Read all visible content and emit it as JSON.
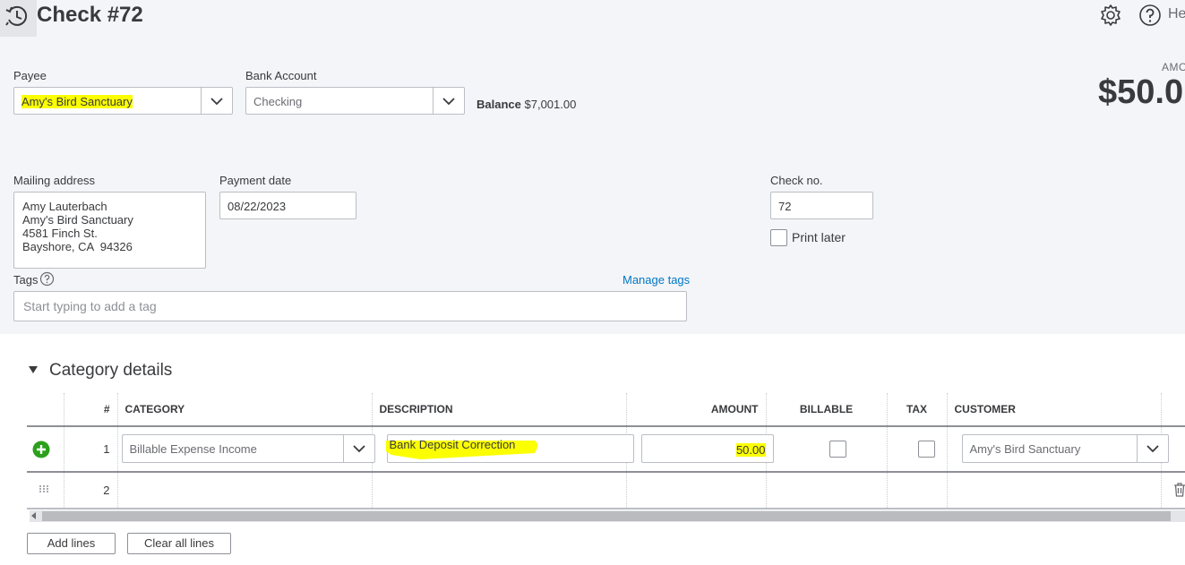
{
  "header": {
    "title": "Check #72",
    "help_label": "He",
    "amount_label": "AMO",
    "amount_value": "$50.0"
  },
  "payee": {
    "label": "Payee",
    "value": "Amy's Bird Sanctuary"
  },
  "bank_account": {
    "label": "Bank Account",
    "value": "Checking",
    "balance_label": "Balance",
    "balance_value": "$7,001.00"
  },
  "mailing_address": {
    "label": "Mailing address",
    "lines": [
      "Amy Lauterbach",
      "Amy's Bird Sanctuary",
      "4581 Finch St.",
      "Bayshore, CA  94326"
    ]
  },
  "payment_date": {
    "label": "Payment date",
    "value": "08/22/2023"
  },
  "check_no": {
    "label": "Check no.",
    "value": "72",
    "print_later_label": "Print later"
  },
  "tags": {
    "label": "Tags",
    "placeholder": "Start typing to add a tag",
    "manage_label": "Manage tags"
  },
  "category_details": {
    "title": "Category details",
    "columns": [
      "#",
      "CATEGORY",
      "DESCRIPTION",
      "AMOUNT",
      "BILLABLE",
      "TAX",
      "CUSTOMER"
    ],
    "rows": [
      {
        "num": "1",
        "category": "Billable Expense Income",
        "description": "Bank Deposit Correction",
        "amount": "50.00",
        "customer": "Amy's Bird Sanctuary"
      },
      {
        "num": "2",
        "category": "",
        "description": "",
        "amount": "",
        "customer": ""
      }
    ]
  },
  "buttons": {
    "add_lines": "Add lines",
    "clear_all_lines": "Clear all lines"
  },
  "colors": {
    "highlight": "#fcff00",
    "link": "#0077c5",
    "add_green": "#2ca01c"
  }
}
